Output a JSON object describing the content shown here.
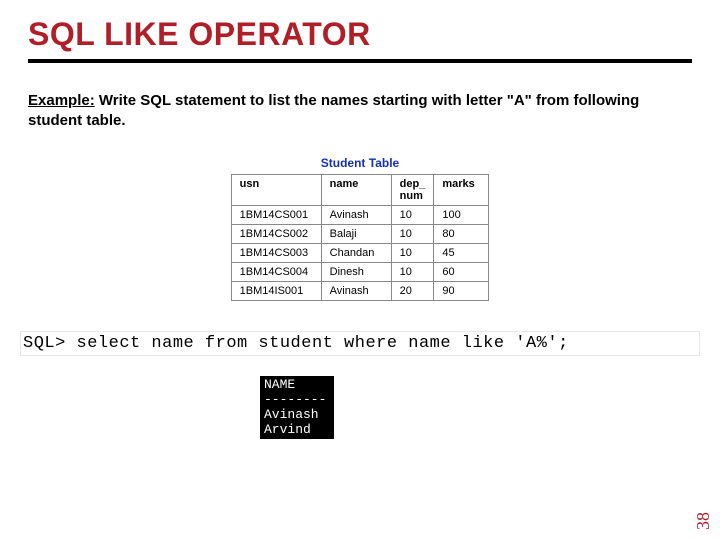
{
  "title": "SQL LIKE OPERATOR",
  "example": {
    "lead": "Example:",
    "text": " Write SQL statement to list the names starting with letter \"A\" from following student table."
  },
  "table": {
    "caption": "Student Table",
    "headers": {
      "usn": "usn",
      "name": "name",
      "dep_num": "dep_\nnum",
      "marks": "marks"
    },
    "rows": [
      {
        "usn": "1BM14CS001",
        "name": "Avinash",
        "dep_num": "10",
        "marks": "100"
      },
      {
        "usn": "1BM14CS002",
        "name": "Balaji",
        "dep_num": "10",
        "marks": "80"
      },
      {
        "usn": "1BM14CS003",
        "name": "Chandan",
        "dep_num": "10",
        "marks": "45"
      },
      {
        "usn": "1BM14CS004",
        "name": "Dinesh",
        "dep_num": "10",
        "marks": "60"
      },
      {
        "usn": "1BM14IS001",
        "name": "Avinash",
        "dep_num": "20",
        "marks": "90"
      }
    ]
  },
  "sql": "SQL> select name from student where name like 'A%';",
  "result": {
    "header": "NAME",
    "sep": "--------",
    "rows": [
      "Avinash",
      "Arvind"
    ]
  },
  "page_num": "38"
}
